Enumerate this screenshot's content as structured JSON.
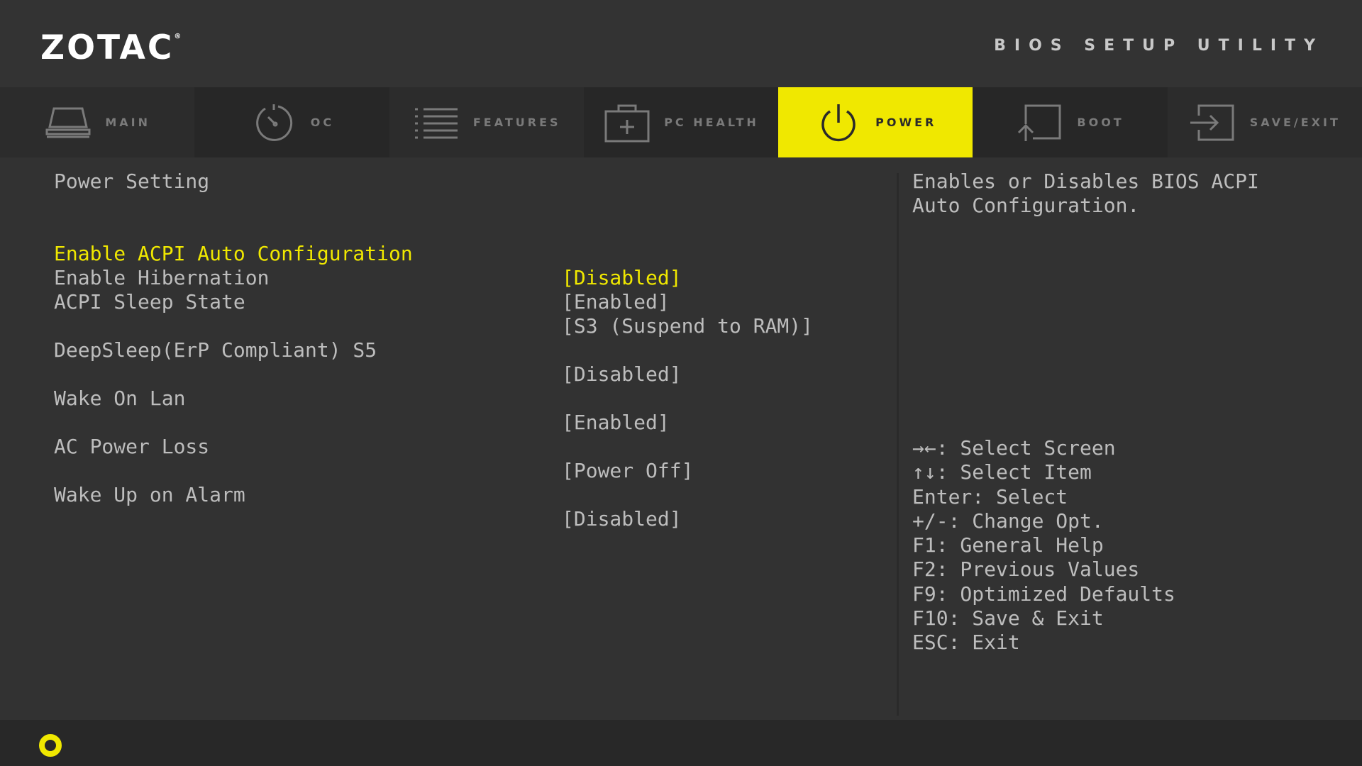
{
  "header": {
    "brand": "ZOTAC",
    "brand_mark": "®",
    "title": "BIOS SETUP UTILITY"
  },
  "tabs": [
    {
      "id": "main",
      "label": "MAIN",
      "icon": "laptop-icon",
      "active": false
    },
    {
      "id": "oc",
      "label": "OC",
      "icon": "speedometer-icon",
      "active": false
    },
    {
      "id": "features",
      "label": "FEATURES",
      "icon": "list-icon",
      "active": false
    },
    {
      "id": "pc-health",
      "label": "PC HEALTH",
      "icon": "medical-kit-icon",
      "active": false
    },
    {
      "id": "power",
      "label": "POWER",
      "icon": "power-icon",
      "active": true
    },
    {
      "id": "boot",
      "label": "BOOT",
      "icon": "boot-icon",
      "active": false
    },
    {
      "id": "save-exit",
      "label": "SAVE/EXIT",
      "icon": "exit-icon",
      "active": false
    }
  ],
  "section_title": "Power Setting",
  "settings": [
    {
      "label": "Enable ACPI Auto Configuration",
      "value": "[Disabled]",
      "selected": true
    },
    {
      "label": "Enable Hibernation",
      "value": "[Enabled]",
      "selected": false
    },
    {
      "label": "ACPI Sleep State",
      "value": "[S3 (Suspend to RAM)]",
      "selected": false
    },
    {
      "label": "DeepSleep(ErP Compliant) S5",
      "value": "[Disabled]",
      "selected": false
    },
    {
      "label": "Wake On Lan",
      "value": "[Enabled]",
      "selected": false
    },
    {
      "label": "AC Power Loss",
      "value": "[Power Off]",
      "selected": false
    },
    {
      "label": "Wake Up on Alarm",
      "value": "[Disabled]",
      "selected": false
    }
  ],
  "help_text": "Enables or Disables BIOS ACPI\nAuto Configuration.",
  "key_help": [
    "→←: Select Screen",
    "↑↓: Select Item",
    "Enter: Select",
    "+/-: Change Opt.",
    "F1: General Help",
    "F2: Previous Values",
    "F9: Optimized Defaults",
    "F10: Save & Exit",
    "ESC: Exit"
  ],
  "colors": {
    "accent": "#f0e800",
    "background": "#323232",
    "text": "#bdbdbd"
  },
  "footer": {
    "icon": "zotac-ring-icon"
  }
}
